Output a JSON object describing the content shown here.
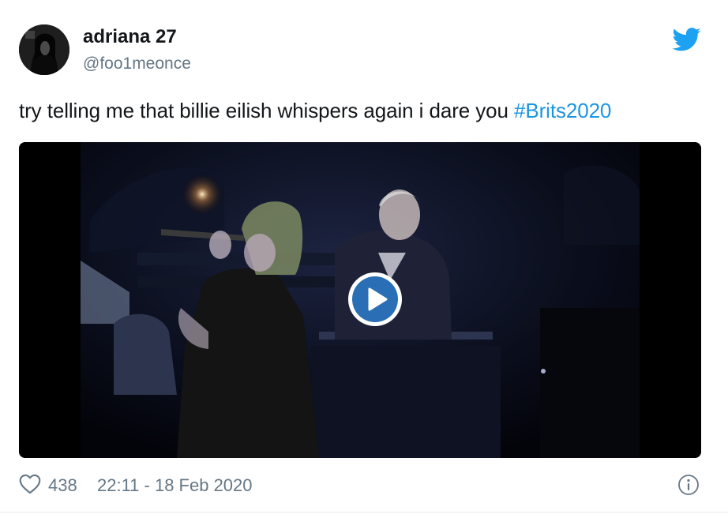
{
  "user": {
    "display_name": "adriana 27",
    "handle": "@foo1meonce",
    "avatar_icon": "profile-photo"
  },
  "tweet": {
    "text": "try telling me that billie eilish whispers again i dare you ",
    "hashtag": "#Brits2020"
  },
  "media": {
    "type": "video",
    "play_icon": "play-icon"
  },
  "footer": {
    "like_count": "438",
    "timestamp": "22:11 - 18 Feb 2020",
    "heart_icon": "heart-icon",
    "info_icon": "info-icon"
  },
  "colors": {
    "link": "#1b95e0",
    "twitter_blue": "#1da1f2",
    "muted": "#657786",
    "play_button": "#2a6fb5"
  }
}
